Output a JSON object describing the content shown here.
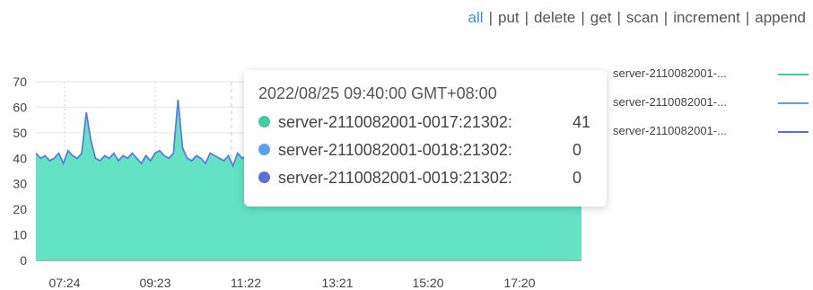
{
  "filters": [
    {
      "label": "all",
      "active": true
    },
    {
      "label": "put",
      "active": false
    },
    {
      "label": "delete",
      "active": false
    },
    {
      "label": "get",
      "active": false
    },
    {
      "label": "scan",
      "active": false
    },
    {
      "label": "increment",
      "active": false
    },
    {
      "label": "append",
      "active": false
    }
  ],
  "legend": [
    {
      "label": "server-2110082001-...",
      "color": "#3fcf9f"
    },
    {
      "label": "server-2110082001-...",
      "color": "#5ba1f2"
    },
    {
      "label": "server-2110082001-...",
      "color": "#5b6fd9"
    }
  ],
  "tooltip": {
    "title": "2022/08/25 09:40:00 GMT+08:00",
    "rows": [
      {
        "name": "server-2110082001-0017:21302:",
        "value": "41",
        "color": "#3fcf9f"
      },
      {
        "name": "server-2110082001-0018:21302:",
        "value": "0",
        "color": "#5ba1f2"
      },
      {
        "name": "server-2110082001-0019:21302:",
        "value": "0",
        "color": "#5b6fd9"
      }
    ]
  },
  "chart_data": {
    "type": "area",
    "ylim": [
      0,
      70
    ],
    "y_ticks": [
      0,
      10,
      20,
      30,
      40,
      50,
      60,
      70
    ],
    "x_tick_labels": [
      "07:24",
      "09:23",
      "11:22",
      "13:21",
      "15:20",
      "17:20"
    ],
    "grid": true,
    "legend_position": "right",
    "series": [
      {
        "values": [
          42,
          40,
          41,
          39,
          40,
          42,
          38,
          43,
          41,
          40,
          42,
          58,
          47,
          40,
          39,
          41,
          40,
          42,
          39,
          41,
          40,
          42,
          40,
          38,
          41,
          39,
          42,
          43,
          41,
          40,
          42,
          63,
          44,
          40,
          39,
          41,
          40,
          38,
          42,
          41,
          40,
          39,
          41,
          37,
          42,
          40,
          41,
          39,
          40,
          42,
          41,
          40,
          42,
          59,
          46,
          40,
          39,
          41,
          43,
          40,
          38,
          41,
          40,
          42,
          39,
          41,
          37,
          42,
          40,
          41,
          39,
          40,
          43,
          41,
          40,
          62,
          44,
          40,
          39,
          41,
          40,
          42,
          40,
          38,
          41,
          39,
          42,
          40,
          41,
          40,
          39,
          42,
          40,
          41,
          39,
          40,
          41,
          42,
          40,
          41,
          39,
          40,
          41,
          40,
          42,
          41,
          40,
          41,
          39,
          40,
          41,
          42,
          40,
          41,
          40,
          41,
          42,
          41,
          40,
          41
        ]
      }
    ]
  }
}
